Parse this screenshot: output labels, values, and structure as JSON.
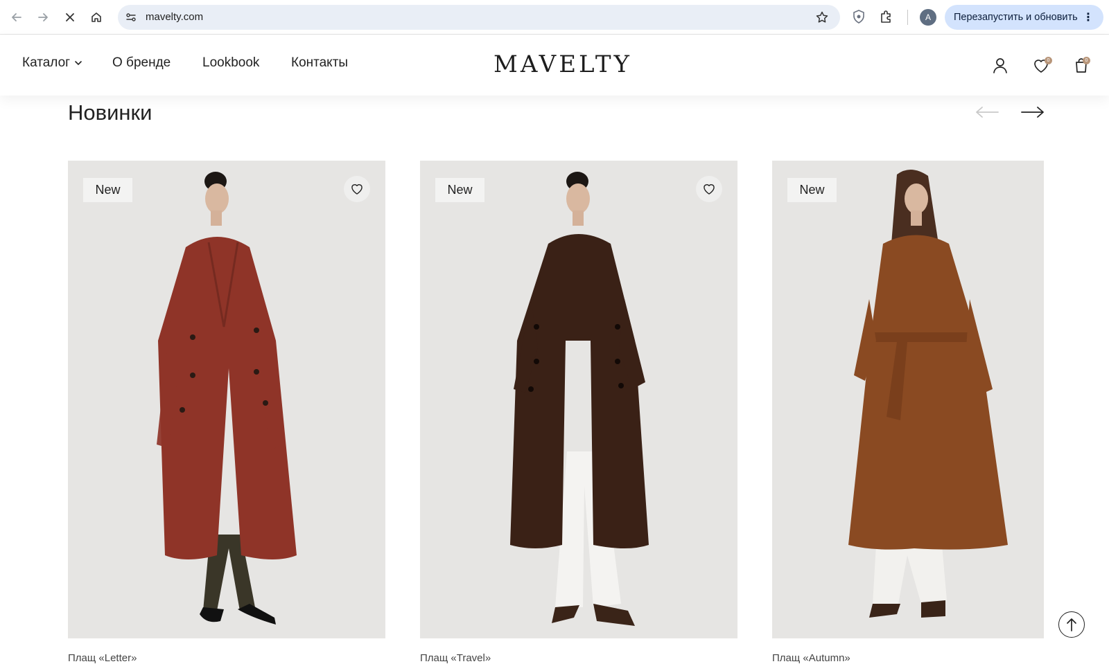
{
  "browser": {
    "url": "mavelty.com",
    "avatar_letter": "A",
    "relaunch_label": "Перезапустить и обновить",
    "relaunch_menu": "⋮"
  },
  "header": {
    "menu": {
      "catalog": "Каталог",
      "about": "О бренде",
      "lookbook": "Lookbook",
      "contacts": "Контакты"
    },
    "logo": "MAVELTY",
    "favorites_count": "0",
    "cart_count": "0"
  },
  "section": {
    "title": "Новинки"
  },
  "products": [
    {
      "badge": "New",
      "coat_color": "#8f3428",
      "inner_color": "#1a1a1a",
      "pants_color": "#3a3628",
      "caption": "Плащ «Letter»"
    },
    {
      "badge": "New",
      "coat_color": "#3a2116",
      "inner_color": "#f4f3f1",
      "pants_color": "#f4f3f1",
      "caption": "Плащ «Travel»"
    },
    {
      "badge": "New",
      "coat_color": "#8a4a22",
      "inner_color": "#f4f3f1",
      "pants_color": "#f2f1ee",
      "caption": "Плащ «Autumn»"
    }
  ],
  "colors": {
    "card_bg": "#e6e5e3",
    "badge_bg": "#f3f3f2",
    "accent_badge": "#b8967a"
  }
}
